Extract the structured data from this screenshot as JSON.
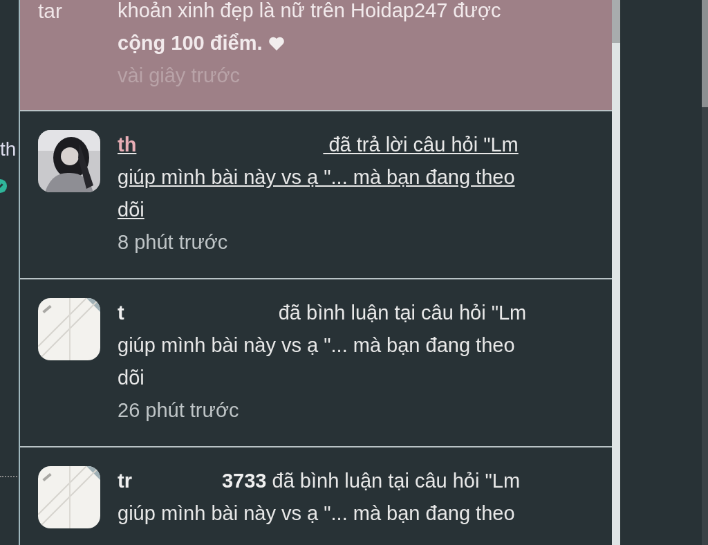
{
  "sidebar": {
    "fragment": "th"
  },
  "notifications": [
    {
      "kind": "announcement",
      "label": "tar",
      "text": "khoản xinh đẹp là nữ trên Hoidap247 được",
      "bonus": "cộng 100 điểm.",
      "time": "vài giây trước",
      "unread": true
    },
    {
      "kind": "activity",
      "has_photo": true,
      "user_start": "th",
      "message": "đã trả lời câu hỏi \"Lm giúp mình bài này vs ạ \"... mà bạn đang theo dõi",
      "time": "8 phút trước",
      "underlined": true,
      "unread": false
    },
    {
      "kind": "activity",
      "has_photo": false,
      "user_start": "t",
      "message": "đã bình luận tại câu hỏi \"Lm giúp mình bài này vs ạ \"... mà bạn đang theo dõi",
      "time": "26 phút trước",
      "underlined": false,
      "unread": false
    },
    {
      "kind": "activity",
      "has_photo": false,
      "user_start": "tr",
      "user_end": "3733",
      "message": "đã bình luận tại câu hỏi \"Lm giúp mình bài này vs ạ \"... mà bạn đang theo",
      "underlined": false,
      "unread": false
    }
  ]
}
